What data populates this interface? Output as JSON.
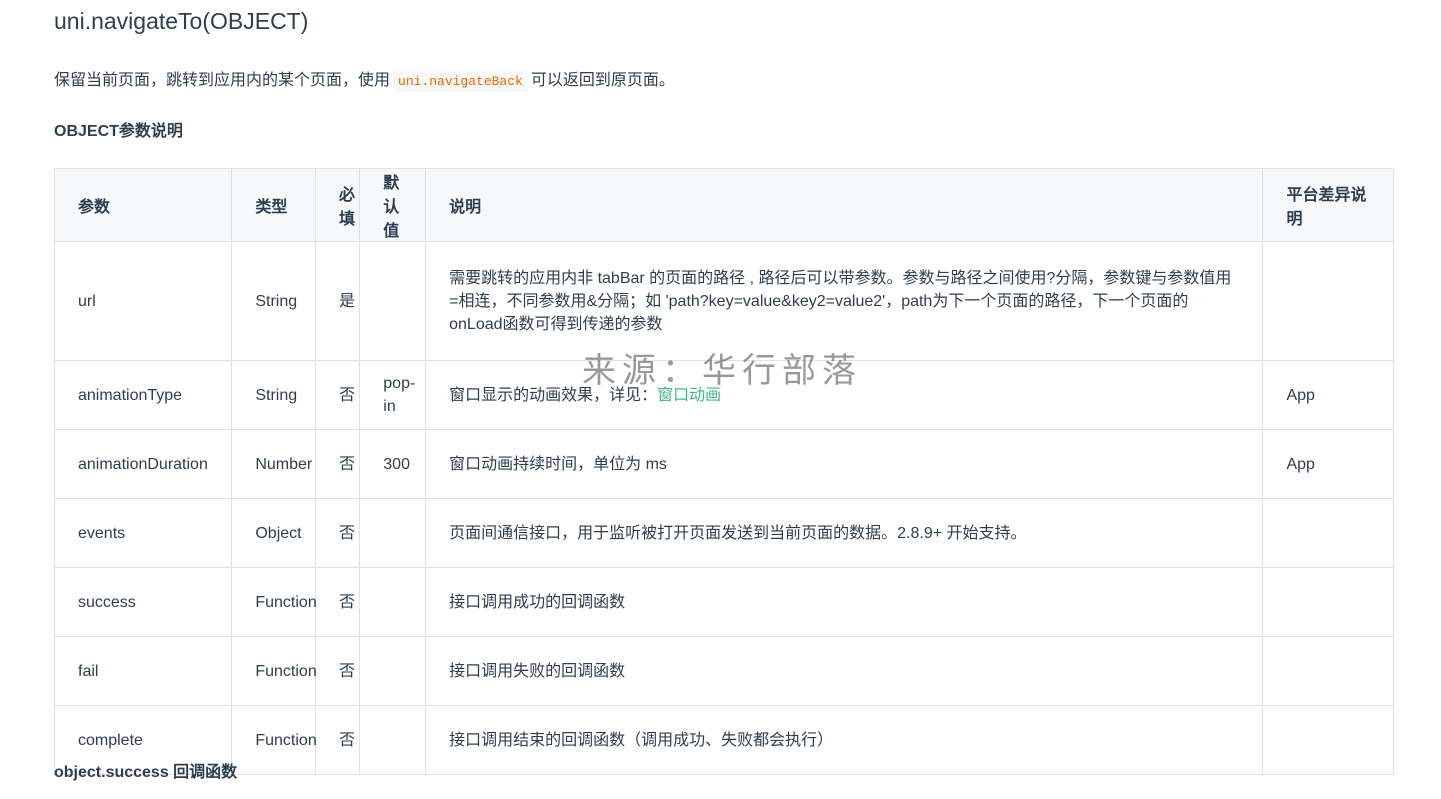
{
  "api": {
    "title": "uni.navigateTo(OBJECT)",
    "description_before": "保留当前页面，跳转到应用内的某个页面，使用",
    "description_code": "uni.navigateBack",
    "description_after": "可以返回到原页面。"
  },
  "params_heading": "OBJECT参数说明",
  "table": {
    "headers": [
      "参数",
      "类型",
      "必填",
      "默认值",
      "说明",
      "平台差异说明"
    ],
    "rows": [
      {
        "name": "url",
        "type": "String",
        "required": "是",
        "default": "",
        "desc": "需要跳转的应用内非 tabBar 的页面的路径 , 路径后可以带参数。参数与路径之间使用?分隔，参数键与参数值用=相连，不同参数用&分隔；如 'path?key=value&key2=value2'，path为下一个页面的路径，下一个页面的onLoad函数可得到传递的参数",
        "platform": ""
      },
      {
        "name": "animationType",
        "type": "String",
        "required": "否",
        "default": "pop-in",
        "desc": "窗口显示的动画效果，详见：",
        "desc_link": "窗口动画",
        "platform": "App"
      },
      {
        "name": "animationDuration",
        "type": "Number",
        "required": "否",
        "default": "300",
        "desc": "窗口动画持续时间，单位为 ms",
        "platform": "App"
      },
      {
        "name": "events",
        "type": "Object",
        "required": "否",
        "default": "",
        "desc": "页面间通信接口，用于监听被打开页面发送到当前页面的数据。2.8.9+ 开始支持。",
        "platform": ""
      },
      {
        "name": "success",
        "type": "Function",
        "required": "否",
        "default": "",
        "desc": "接口调用成功的回调函数",
        "platform": ""
      },
      {
        "name": "fail",
        "type": "Function",
        "required": "否",
        "default": "",
        "desc": "接口调用失败的回调函数",
        "platform": ""
      },
      {
        "name": "complete",
        "type": "Function",
        "required": "否",
        "default": "",
        "desc": "接口调用结束的回调函数（调用成功、失败都会执行）",
        "platform": ""
      }
    ]
  },
  "success_heading": "object.success 回调函数",
  "watermark": "来源：华行部落",
  "colors": {
    "text": "#2c3e50",
    "code": "#e96900",
    "link": "#42b983",
    "border": "#dfe2e5",
    "header_bg": "#f6f8fa"
  }
}
